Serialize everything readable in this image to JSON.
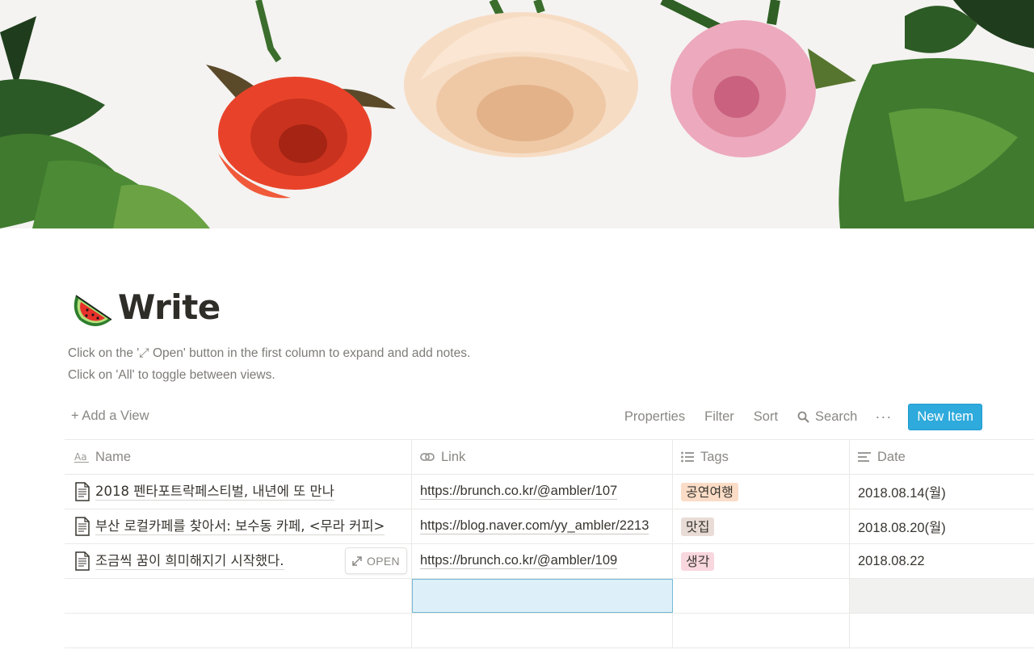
{
  "page": {
    "title": "Write",
    "title_icon": "watermelon-icon",
    "description": [
      "Click on the '⤢ Open' button in the first column to expand and add notes.",
      "Click on 'All' to toggle between views."
    ]
  },
  "toolbar": {
    "add_view": "+ Add a View",
    "properties": "Properties",
    "filter": "Filter",
    "sort": "Sort",
    "search": "Search",
    "more": "···",
    "new_item": "New Item"
  },
  "table": {
    "headers": {
      "name": "Name",
      "link": "Link",
      "tags": "Tags",
      "date": "Date"
    },
    "open_label": "OPEN",
    "rows": [
      {
        "name": "2018 펜타포트락페스티벌, 내년에 또 만나",
        "link": "https://brunch.co.kr/@ambler/107",
        "tag": "공연여행",
        "tag_color": "#fbdcc6",
        "date": "2018.08.14(월)"
      },
      {
        "name": "부산 로컬카페를 찾아서: 보수동 카페, <무라 커피>",
        "link": "https://blog.naver.com/yy_ambler/2213",
        "tag": "맛집",
        "tag_color": "#e9dcd6",
        "date": "2018.08.20(월)"
      },
      {
        "name": "조금씩 꿈이 희미해지기 시작했다.",
        "link": "https://brunch.co.kr/@ambler/109",
        "tag": "생각",
        "tag_color": "#f9d7de",
        "date": "2018.08.22"
      }
    ]
  },
  "colors": {
    "accent": "#2eaadc",
    "text": "#37352f",
    "muted": "#8a8883"
  }
}
